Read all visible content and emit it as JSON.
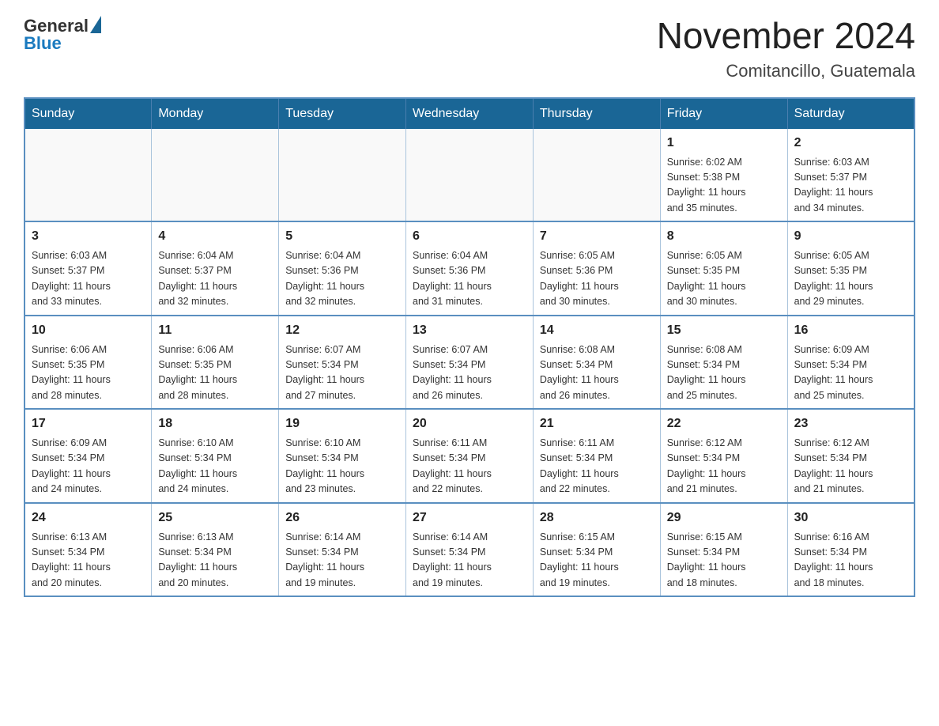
{
  "header": {
    "logo_general": "General",
    "logo_blue": "Blue",
    "title": "November 2024",
    "subtitle": "Comitancillo, Guatemala"
  },
  "weekdays": [
    "Sunday",
    "Monday",
    "Tuesday",
    "Wednesday",
    "Thursday",
    "Friday",
    "Saturday"
  ],
  "weeks": [
    [
      {
        "day": "",
        "info": ""
      },
      {
        "day": "",
        "info": ""
      },
      {
        "day": "",
        "info": ""
      },
      {
        "day": "",
        "info": ""
      },
      {
        "day": "",
        "info": ""
      },
      {
        "day": "1",
        "info": "Sunrise: 6:02 AM\nSunset: 5:38 PM\nDaylight: 11 hours\nand 35 minutes."
      },
      {
        "day": "2",
        "info": "Sunrise: 6:03 AM\nSunset: 5:37 PM\nDaylight: 11 hours\nand 34 minutes."
      }
    ],
    [
      {
        "day": "3",
        "info": "Sunrise: 6:03 AM\nSunset: 5:37 PM\nDaylight: 11 hours\nand 33 minutes."
      },
      {
        "day": "4",
        "info": "Sunrise: 6:04 AM\nSunset: 5:37 PM\nDaylight: 11 hours\nand 32 minutes."
      },
      {
        "day": "5",
        "info": "Sunrise: 6:04 AM\nSunset: 5:36 PM\nDaylight: 11 hours\nand 32 minutes."
      },
      {
        "day": "6",
        "info": "Sunrise: 6:04 AM\nSunset: 5:36 PM\nDaylight: 11 hours\nand 31 minutes."
      },
      {
        "day": "7",
        "info": "Sunrise: 6:05 AM\nSunset: 5:36 PM\nDaylight: 11 hours\nand 30 minutes."
      },
      {
        "day": "8",
        "info": "Sunrise: 6:05 AM\nSunset: 5:35 PM\nDaylight: 11 hours\nand 30 minutes."
      },
      {
        "day": "9",
        "info": "Sunrise: 6:05 AM\nSunset: 5:35 PM\nDaylight: 11 hours\nand 29 minutes."
      }
    ],
    [
      {
        "day": "10",
        "info": "Sunrise: 6:06 AM\nSunset: 5:35 PM\nDaylight: 11 hours\nand 28 minutes."
      },
      {
        "day": "11",
        "info": "Sunrise: 6:06 AM\nSunset: 5:35 PM\nDaylight: 11 hours\nand 28 minutes."
      },
      {
        "day": "12",
        "info": "Sunrise: 6:07 AM\nSunset: 5:34 PM\nDaylight: 11 hours\nand 27 minutes."
      },
      {
        "day": "13",
        "info": "Sunrise: 6:07 AM\nSunset: 5:34 PM\nDaylight: 11 hours\nand 26 minutes."
      },
      {
        "day": "14",
        "info": "Sunrise: 6:08 AM\nSunset: 5:34 PM\nDaylight: 11 hours\nand 26 minutes."
      },
      {
        "day": "15",
        "info": "Sunrise: 6:08 AM\nSunset: 5:34 PM\nDaylight: 11 hours\nand 25 minutes."
      },
      {
        "day": "16",
        "info": "Sunrise: 6:09 AM\nSunset: 5:34 PM\nDaylight: 11 hours\nand 25 minutes."
      }
    ],
    [
      {
        "day": "17",
        "info": "Sunrise: 6:09 AM\nSunset: 5:34 PM\nDaylight: 11 hours\nand 24 minutes."
      },
      {
        "day": "18",
        "info": "Sunrise: 6:10 AM\nSunset: 5:34 PM\nDaylight: 11 hours\nand 24 minutes."
      },
      {
        "day": "19",
        "info": "Sunrise: 6:10 AM\nSunset: 5:34 PM\nDaylight: 11 hours\nand 23 minutes."
      },
      {
        "day": "20",
        "info": "Sunrise: 6:11 AM\nSunset: 5:34 PM\nDaylight: 11 hours\nand 22 minutes."
      },
      {
        "day": "21",
        "info": "Sunrise: 6:11 AM\nSunset: 5:34 PM\nDaylight: 11 hours\nand 22 minutes."
      },
      {
        "day": "22",
        "info": "Sunrise: 6:12 AM\nSunset: 5:34 PM\nDaylight: 11 hours\nand 21 minutes."
      },
      {
        "day": "23",
        "info": "Sunrise: 6:12 AM\nSunset: 5:34 PM\nDaylight: 11 hours\nand 21 minutes."
      }
    ],
    [
      {
        "day": "24",
        "info": "Sunrise: 6:13 AM\nSunset: 5:34 PM\nDaylight: 11 hours\nand 20 minutes."
      },
      {
        "day": "25",
        "info": "Sunrise: 6:13 AM\nSunset: 5:34 PM\nDaylight: 11 hours\nand 20 minutes."
      },
      {
        "day": "26",
        "info": "Sunrise: 6:14 AM\nSunset: 5:34 PM\nDaylight: 11 hours\nand 19 minutes."
      },
      {
        "day": "27",
        "info": "Sunrise: 6:14 AM\nSunset: 5:34 PM\nDaylight: 11 hours\nand 19 minutes."
      },
      {
        "day": "28",
        "info": "Sunrise: 6:15 AM\nSunset: 5:34 PM\nDaylight: 11 hours\nand 19 minutes."
      },
      {
        "day": "29",
        "info": "Sunrise: 6:15 AM\nSunset: 5:34 PM\nDaylight: 11 hours\nand 18 minutes."
      },
      {
        "day": "30",
        "info": "Sunrise: 6:16 AM\nSunset: 5:34 PM\nDaylight: 11 hours\nand 18 minutes."
      }
    ]
  ]
}
